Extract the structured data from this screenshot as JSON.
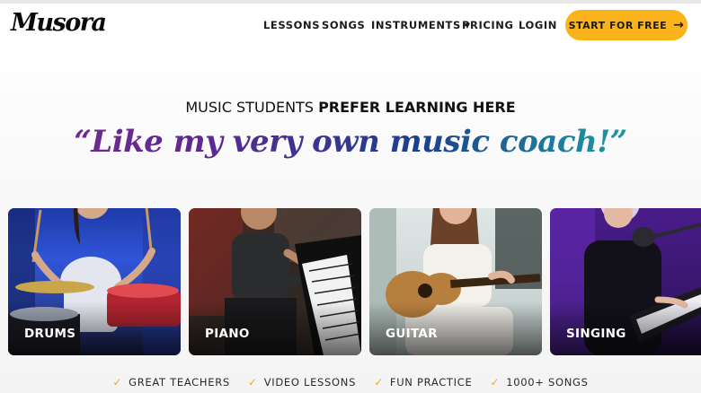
{
  "brand": {
    "logo_text": "Musora"
  },
  "nav": {
    "links": [
      "LESSONS",
      "SONGS",
      "INSTRUMENTS",
      "PRICING",
      "LOGIN"
    ],
    "cta_label": "START FOR FREE"
  },
  "hero": {
    "kicker_regular": "MUSIC STUDENTS ",
    "kicker_bold": "PREFER LEARNING HERE",
    "quote": "“Like my very own music coach!”"
  },
  "cards": [
    {
      "label": "DRUMS"
    },
    {
      "label": "PIANO"
    },
    {
      "label": "GUITAR"
    },
    {
      "label": "SINGING"
    }
  ],
  "features": [
    "GREAT TEACHERS",
    "VIDEO LESSONS",
    "FUN PRACTICE",
    "1000+ SONGS"
  ],
  "colors": {
    "accent": "#fbb31b",
    "check": "#f0a81c",
    "quote_start": "#7a2a8f",
    "quote_end": "#2aa2a6"
  }
}
